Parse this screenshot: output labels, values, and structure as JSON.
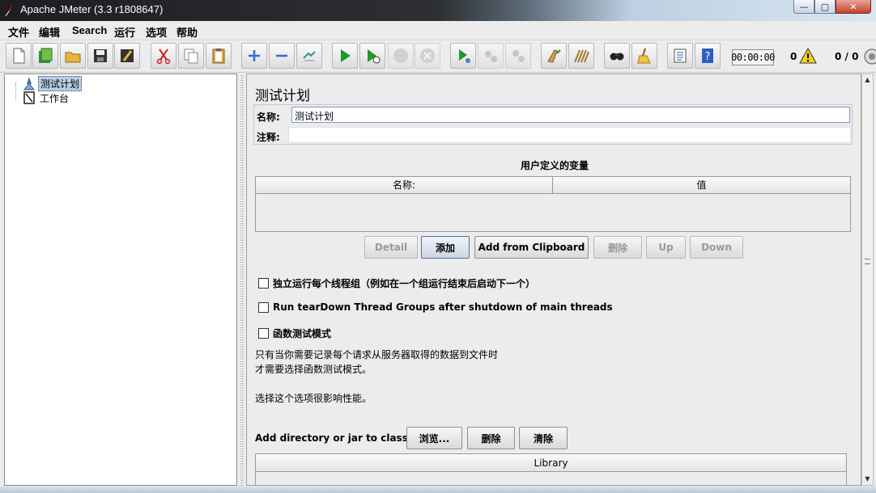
{
  "window": {
    "title": "Apache JMeter (3.3 r1808647)"
  },
  "window_controls": {
    "minimize": "—",
    "maximize": "▢",
    "close": "✕"
  },
  "menu": [
    "文件",
    "编辑",
    "Search",
    "运行",
    "选项",
    "帮助"
  ],
  "toolbar": {
    "buttons": [
      "new-icon",
      "templates-icon",
      "open-icon",
      "save-icon",
      "save-screenshot-icon",
      "cut-icon",
      "copy-icon",
      "paste-icon",
      "expand-icon",
      "collapse-icon",
      "toggle-icon",
      "start-icon",
      "start-no-timers-icon",
      "stop-icon",
      "shutdown-icon",
      "remote-start-icon",
      "remote-stop-icon",
      "remote-exit-icon",
      "clear-icon",
      "clear-all-icon",
      "search-icon",
      "reset-search-icon",
      "function-helper-icon",
      "help-icon"
    ],
    "timer": "00:00:00",
    "error_count": "0",
    "threads": "0 / 0"
  },
  "tree": {
    "items": [
      "测试计划",
      "工作台"
    ]
  },
  "panel": {
    "title": "测试计划",
    "name_label": "名称:",
    "name_value": "测试计划",
    "comment_label": "注释:",
    "comment_value": "",
    "user_vars_title": "用户定义的变量",
    "table_headers": [
      "名称:",
      "值"
    ],
    "buttons": [
      "Detail",
      "添加",
      "Add from Clipboard",
      "删除",
      "Up",
      "Down"
    ],
    "checkboxes": [
      "独立运行每个线程组（例如在一个组运行结束后启动下一个）",
      "Run tearDown Thread Groups after shutdown of main threads",
      "函数测试模式"
    ],
    "note_lines": [
      "只有当你需要记录每个请求从服务器取得的数据到文件时",
      "才需要选择函数测试模式。",
      "选择这个选项很影响性能。"
    ],
    "classpath_label": "Add directory or jar to classpath",
    "classpath_buttons": [
      "浏览...",
      "删除",
      "清除"
    ],
    "library_header": "Library"
  }
}
